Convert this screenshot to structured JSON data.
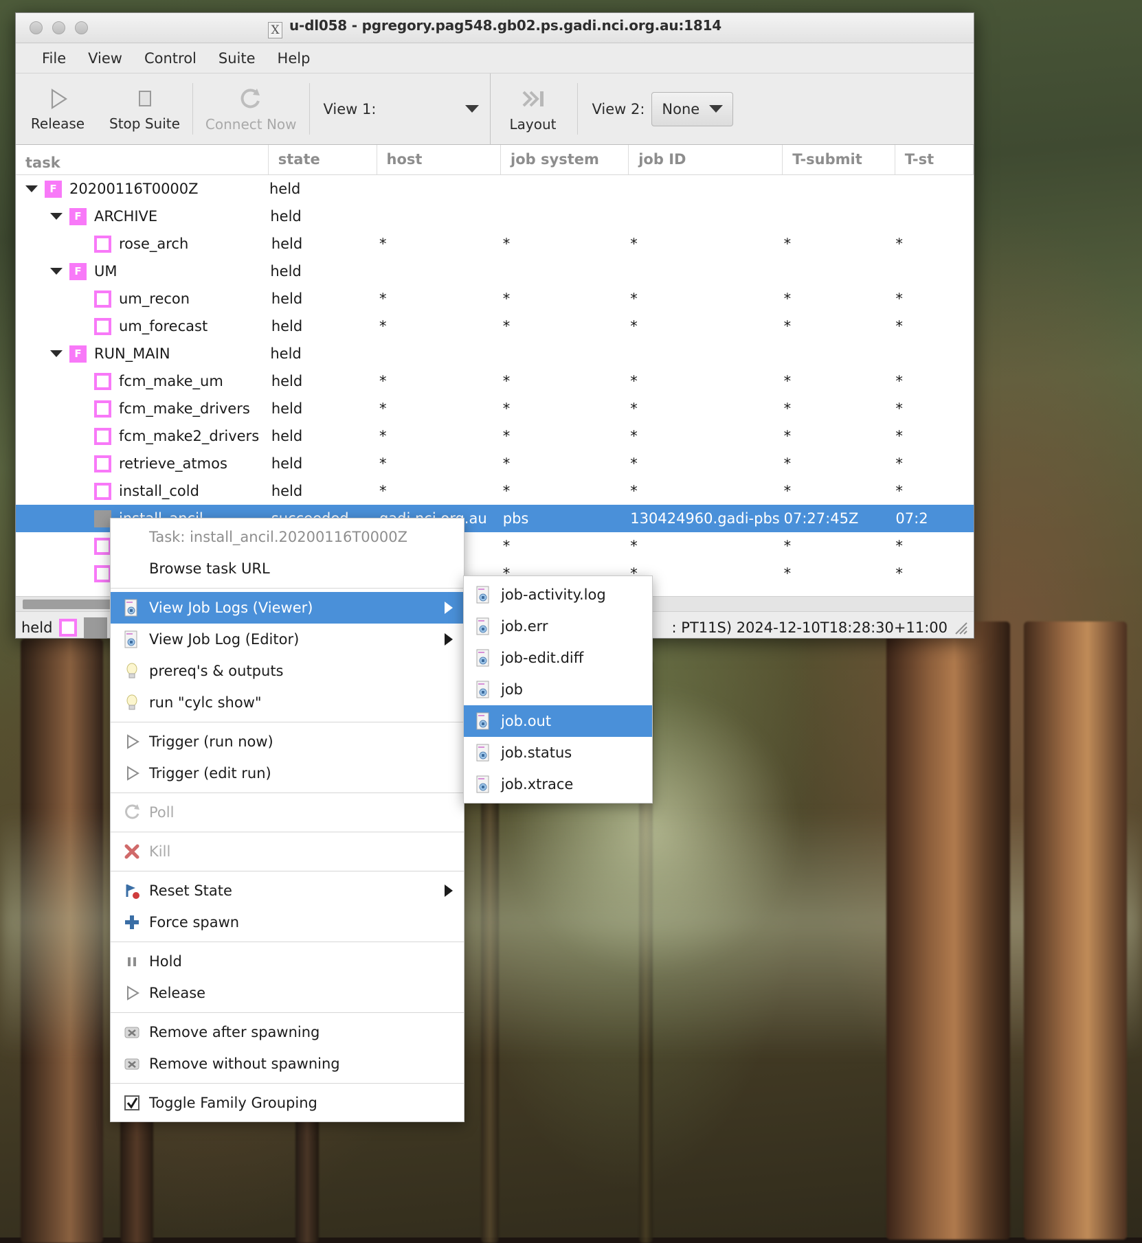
{
  "window": {
    "title": "u-dl058 - pgregory.pag548.gb02.ps.gadi.nci.org.au:1814",
    "xlogo": "X"
  },
  "menubar": {
    "items": [
      {
        "label": "File"
      },
      {
        "label": "View"
      },
      {
        "label": "Control"
      },
      {
        "label": "Suite"
      },
      {
        "label": "Help"
      }
    ]
  },
  "toolbar": {
    "release_label": "Release",
    "stop_suite_label": "Stop Suite",
    "connect_now_label": "Connect Now",
    "view1_label": "View 1:",
    "layout_label": "Layout",
    "view2_label": "View 2:",
    "view2_value": "None"
  },
  "table": {
    "columns": [
      {
        "key": "task",
        "label": "task"
      },
      {
        "key": "state",
        "label": "state"
      },
      {
        "key": "host",
        "label": "host"
      },
      {
        "key": "jobsystem",
        "label": "job system"
      },
      {
        "key": "jobid",
        "label": "job ID"
      },
      {
        "key": "tsubmit",
        "label": "T-submit"
      },
      {
        "key": "tstart",
        "label": "T-st"
      }
    ],
    "rows": [
      {
        "kind": "family",
        "depth": 0,
        "expanded": true,
        "badge": "F",
        "task": "20200116T0000Z",
        "state": "held",
        "host": "",
        "jobsystem": "",
        "jobid": "",
        "tsubmit": "",
        "tstart": ""
      },
      {
        "kind": "family",
        "depth": 1,
        "expanded": true,
        "badge": "F",
        "task": "ARCHIVE",
        "state": "held",
        "host": "",
        "jobsystem": "",
        "jobid": "",
        "tsubmit": "",
        "tstart": ""
      },
      {
        "kind": "task",
        "depth": 2,
        "task": "rose_arch",
        "state": "held",
        "host": "*",
        "jobsystem": "*",
        "jobid": "*",
        "tsubmit": "*",
        "tstart": "*"
      },
      {
        "kind": "family",
        "depth": 1,
        "expanded": true,
        "badge": "F",
        "task": "UM",
        "state": "held",
        "host": "",
        "jobsystem": "",
        "jobid": "",
        "tsubmit": "",
        "tstart": ""
      },
      {
        "kind": "task",
        "depth": 2,
        "task": "um_recon",
        "state": "held",
        "host": "*",
        "jobsystem": "*",
        "jobid": "*",
        "tsubmit": "*",
        "tstart": "*"
      },
      {
        "kind": "task",
        "depth": 2,
        "task": "um_forecast",
        "state": "held",
        "host": "*",
        "jobsystem": "*",
        "jobid": "*",
        "tsubmit": "*",
        "tstart": "*"
      },
      {
        "kind": "family",
        "depth": 1,
        "expanded": true,
        "badge": "F",
        "task": "RUN_MAIN",
        "state": "held",
        "host": "",
        "jobsystem": "",
        "jobid": "",
        "tsubmit": "",
        "tstart": ""
      },
      {
        "kind": "task",
        "depth": 2,
        "task": "fcm_make_um",
        "state": "held",
        "host": "*",
        "jobsystem": "*",
        "jobid": "*",
        "tsubmit": "*",
        "tstart": "*"
      },
      {
        "kind": "task",
        "depth": 2,
        "task": "fcm_make_drivers",
        "state": "held",
        "host": "*",
        "jobsystem": "*",
        "jobid": "*",
        "tsubmit": "*",
        "tstart": "*"
      },
      {
        "kind": "task",
        "depth": 2,
        "task": "fcm_make2_drivers",
        "state": "held",
        "host": "*",
        "jobsystem": "*",
        "jobid": "*",
        "tsubmit": "*",
        "tstart": "*"
      },
      {
        "kind": "task",
        "depth": 2,
        "task": "retrieve_atmos",
        "state": "held",
        "host": "*",
        "jobsystem": "*",
        "jobid": "*",
        "tsubmit": "*",
        "tstart": "*"
      },
      {
        "kind": "task",
        "depth": 2,
        "task": "install_cold",
        "state": "held",
        "host": "*",
        "jobsystem": "*",
        "jobid": "*",
        "tsubmit": "*",
        "tstart": "*"
      },
      {
        "kind": "task",
        "depth": 2,
        "selected": true,
        "task": "install_ancil",
        "state": "succeeded",
        "host": "gadi.nci.org.au",
        "jobsystem": "pbs",
        "jobid": "130424960.gadi-pbs",
        "tsubmit": "07:27:45Z",
        "tstart": "07:2"
      },
      {
        "kind": "task",
        "depth": 2,
        "task": "",
        "state": "",
        "host": "",
        "jobsystem": "*",
        "jobid": "*",
        "tsubmit": "*",
        "tstart": "*"
      },
      {
        "kind": "task",
        "depth": 2,
        "task": "",
        "state": "",
        "host": "",
        "jobsystem": "*",
        "jobid": "*",
        "tsubmit": "*",
        "tstart": "*"
      }
    ]
  },
  "statusbar": {
    "state_label": "held",
    "left_paren": "(",
    "right_text": ": PT11S) 2024-12-10T18:28:30+11:00"
  },
  "context_menu": {
    "header": "Task: install_ancil.20200116T0000Z",
    "items": [
      {
        "label": "Browse task URL",
        "icon": "",
        "submenu": false,
        "disabled": false,
        "highlight": false
      },
      {
        "sep": true
      },
      {
        "label": "View Job Logs (Viewer)",
        "icon": "document-icon",
        "submenu": true,
        "disabled": false,
        "highlight": true
      },
      {
        "label": "View Job Log (Editor)",
        "icon": "document-icon",
        "submenu": true,
        "disabled": false,
        "highlight": false
      },
      {
        "label": "prereq's & outputs",
        "icon": "lightbulb-icon",
        "submenu": false,
        "disabled": false,
        "highlight": false
      },
      {
        "label": "run \"cylc show\"",
        "icon": "lightbulb-icon",
        "submenu": false,
        "disabled": false,
        "highlight": false
      },
      {
        "sep": true
      },
      {
        "label": "Trigger (run now)",
        "icon": "play-icon",
        "submenu": false,
        "disabled": false,
        "highlight": false
      },
      {
        "label": "Trigger (edit run)",
        "icon": "play-icon",
        "submenu": false,
        "disabled": false,
        "highlight": false
      },
      {
        "sep": true
      },
      {
        "label": "Poll",
        "icon": "refresh-icon",
        "submenu": false,
        "disabled": true,
        "highlight": false
      },
      {
        "sep": true
      },
      {
        "label": "Kill",
        "icon": "kill-icon",
        "submenu": false,
        "disabled": true,
        "highlight": false
      },
      {
        "sep": true
      },
      {
        "label": "Reset State",
        "icon": "reset-icon",
        "submenu": true,
        "disabled": false,
        "highlight": false
      },
      {
        "label": "Force spawn",
        "icon": "plus-icon",
        "submenu": false,
        "disabled": false,
        "highlight": false
      },
      {
        "sep": true
      },
      {
        "label": "Hold",
        "icon": "pause-icon",
        "submenu": false,
        "disabled": false,
        "highlight": false
      },
      {
        "label": "Release",
        "icon": "play-icon",
        "submenu": false,
        "disabled": false,
        "highlight": false
      },
      {
        "sep": true
      },
      {
        "label": "Remove after spawning",
        "icon": "remove-icon",
        "submenu": false,
        "disabled": false,
        "highlight": false
      },
      {
        "label": "Remove without spawning",
        "icon": "remove-icon",
        "submenu": false,
        "disabled": false,
        "highlight": false
      },
      {
        "sep": true
      },
      {
        "label": "Toggle Family Grouping",
        "icon": "checkbox-checked-icon",
        "submenu": false,
        "disabled": false,
        "highlight": false
      }
    ]
  },
  "submenu": {
    "items": [
      {
        "label": "job-activity.log",
        "highlight": false
      },
      {
        "label": "job.err",
        "highlight": false
      },
      {
        "label": "job-edit.diff",
        "highlight": false
      },
      {
        "label": "job",
        "highlight": false
      },
      {
        "label": "job.out",
        "highlight": true
      },
      {
        "label": "job.status",
        "highlight": false
      },
      {
        "label": "job.xtrace",
        "highlight": false
      }
    ]
  },
  "colors": {
    "selection_blue": "#4a90d9",
    "family_pink": "#f879f8",
    "window_grey": "#ececec"
  }
}
